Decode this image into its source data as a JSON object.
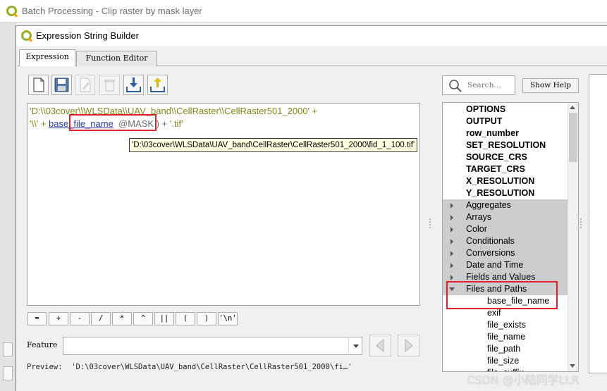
{
  "background_window": {
    "title": "Batch Processing - Clip raster by mask layer"
  },
  "dialog": {
    "title": "Expression String Builder"
  },
  "tabs": [
    {
      "label": "Expression",
      "active": true
    },
    {
      "label": "Function Editor",
      "active": false
    }
  ],
  "toolbar": {
    "icons": [
      "new-file-icon",
      "save-icon",
      "edit-icon",
      "delete-icon",
      "import-icon",
      "export-icon"
    ]
  },
  "editor": {
    "line1": "'D:\\\\03cover\\\\WLSData\\\\UAV_band\\\\CellRaster\\\\CellRaster501_2000' +",
    "line2_start": "'\\\\' + ",
    "line2_fn": "base_file_name",
    "line2_mid": "  @MASK ) + ",
    "line2_end": "'.tif'"
  },
  "tooltip": {
    "text": "'D:\\03cover\\WLSData\\UAV_band\\CellRaster\\CellRaster501_2000\\fid_1_100.tif'"
  },
  "operators": [
    "=",
    "+",
    "-",
    "/",
    "*",
    "^",
    "||",
    "(",
    ")",
    "'\\n'"
  ],
  "feature": {
    "label": "Feature",
    "value": ""
  },
  "preview": {
    "label": "Preview:",
    "value": "'D:\\03cover\\WLSData\\UAV_band\\CellRaster\\CellRaster501_2000\\fi…'"
  },
  "search": {
    "placeholder": "Search…"
  },
  "show_help_label": "Show Help",
  "tree": {
    "variables": [
      "OPTIONS",
      "OUTPUT",
      "row_number",
      "SET_RESOLUTION",
      "SOURCE_CRS",
      "TARGET_CRS",
      "X_RESOLUTION",
      "Y_RESOLUTION"
    ],
    "groups": [
      "Aggregates",
      "Arrays",
      "Color",
      "Conditionals",
      "Conversions",
      "Date and Time",
      "Fields and Values",
      "Files and Paths"
    ],
    "files_children": [
      "base_file_name",
      "exif",
      "file_exists",
      "file_name",
      "file_path",
      "file_size",
      "file_suffix"
    ]
  },
  "watermark": "CSDN @小陆同学LLR",
  "colors": {
    "highlight_red": "#e2202c",
    "string_green": "#7b8a14",
    "tooltip_bg": "#ffffe1",
    "group_gray": "#cdcdcd"
  }
}
